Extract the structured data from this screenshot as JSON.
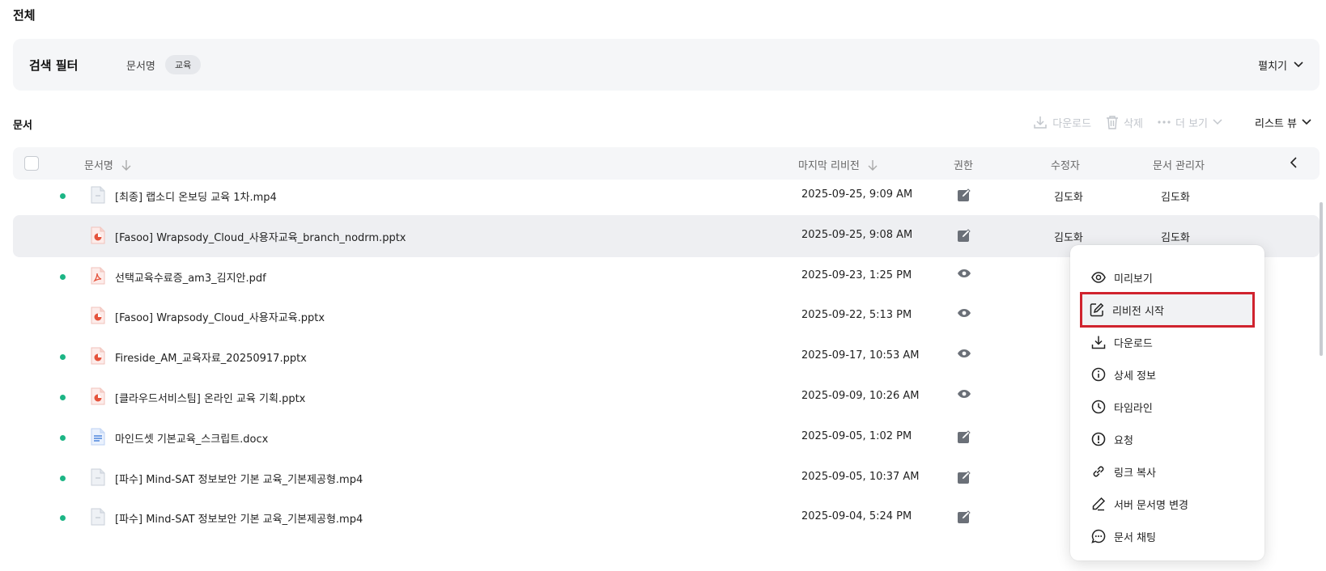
{
  "page": {
    "title": "전체"
  },
  "filter": {
    "title": "검색 필터",
    "key": "문서명",
    "chip": "교육",
    "expand_label": "펼치기"
  },
  "section": {
    "title": "문서"
  },
  "toolbar": {
    "download_label": "다운로드",
    "delete_label": "삭제",
    "more_label": "더 보기",
    "view_label": "리스트 뷰"
  },
  "table": {
    "columns": {
      "name": "문서명",
      "last_revision": "마지막 리비전",
      "permission": "권한",
      "editor": "수정자",
      "manager": "문서 관리자"
    },
    "rows": [
      {
        "name": "[최종] 랩소디 온보딩 교육 1차.mp4",
        "date": "2025-09-25, 9:09 AM",
        "editor": "김도화",
        "manager": "김도화",
        "dot": true,
        "type": "video",
        "perm": "edit-icon"
      },
      {
        "name": "[Fasoo] Wrapsody_Cloud_사용자교육_branch_nodrm.pptx",
        "date": "2025-09-25, 9:08 AM",
        "editor": "김도화",
        "manager": "김도화",
        "dot": false,
        "type": "pptx",
        "perm": "edit-icon"
      },
      {
        "name": "선택교육수료증_am3_김지안.pdf",
        "date": "2025-09-23, 1:25 PM",
        "editor": "",
        "manager": "",
        "dot": true,
        "type": "pdf",
        "perm": "eye-icon"
      },
      {
        "name": "[Fasoo] Wrapsody_Cloud_사용자교육.pptx",
        "date": "2025-09-22, 5:13 PM",
        "editor": "",
        "manager": "",
        "dot": false,
        "type": "pptx",
        "perm": "eye-icon"
      },
      {
        "name": "Fireside_AM_교육자료_20250917.pptx",
        "date": "2025-09-17, 10:53 AM",
        "editor": "",
        "manager": "",
        "dot": true,
        "type": "pptx",
        "perm": "eye-icon"
      },
      {
        "name": "[클라우드서비스팀] 온라인 교육 기획.pptx",
        "date": "2025-09-09, 10:26 AM",
        "editor": "",
        "manager": "",
        "dot": true,
        "type": "pptx",
        "perm": "eye-icon"
      },
      {
        "name": "마인드셋 기본교육_스크립트.docx",
        "date": "2025-09-05, 1:02 PM",
        "editor": "",
        "manager": "",
        "dot": true,
        "type": "docx",
        "perm": "edit-icon"
      },
      {
        "name": "[파수] Mind-SAT 정보보안 기본 교육_기본제공형.mp4",
        "date": "2025-09-05, 10:37 AM",
        "editor": "",
        "manager": "",
        "dot": true,
        "type": "video",
        "perm": "edit-icon"
      },
      {
        "name": "[파수] Mind-SAT 정보보안 기본 교육_기본제공형.mp4",
        "date": "2025-09-04, 5:24 PM",
        "editor": "",
        "manager": "",
        "dot": true,
        "type": "video",
        "perm": "edit-icon"
      }
    ]
  },
  "context_menu": {
    "items": [
      {
        "label": "미리보기",
        "icon": "eye-icon"
      },
      {
        "label": "리비전 시작",
        "icon": "edit-square-icon"
      },
      {
        "label": "다운로드",
        "icon": "download-icon"
      },
      {
        "label": "상세 정보",
        "icon": "info-icon"
      },
      {
        "label": "타임라인",
        "icon": "clock-icon"
      },
      {
        "label": "요청",
        "icon": "alert-icon"
      },
      {
        "label": "링크 복사",
        "icon": "link-icon"
      },
      {
        "label": "서버 문서명 변경",
        "icon": "pencil-icon"
      },
      {
        "label": "문서 채팅",
        "icon": "chat-icon"
      }
    ]
  },
  "colors": {
    "status_dot": "#1cb585",
    "highlight_border": "#d0232e",
    "pptx": "#e5533c",
    "pdf": "#e5533c",
    "docx": "#2f6fd6"
  }
}
